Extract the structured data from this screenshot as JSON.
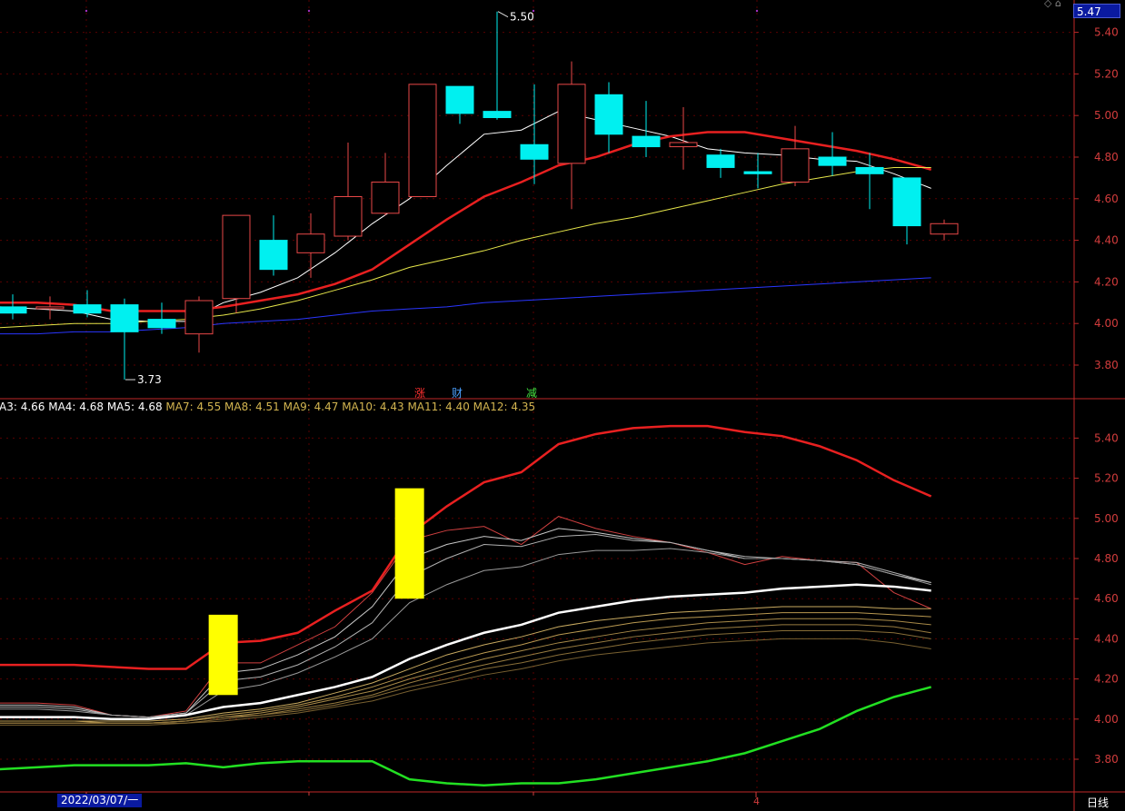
{
  "price_box": "5.47",
  "date_label": "2022/03/07/一",
  "period_label": "日线",
  "month_marker": "4",
  "corner_icons": "◇ ⌂",
  "tags": {
    "zhang": "涨",
    "cai": "财",
    "jian": "减"
  },
  "colors": {
    "up": "#e84848",
    "down": "#00f0f0",
    "axis": "#c02828",
    "grid": "#5a0000"
  },
  "ma_legend": [
    {
      "text": "A3: 4.66",
      "color": "#ffffff"
    },
    {
      "text": "MA4: 4.68",
      "color": "#ffffff"
    },
    {
      "text": "MA5: 4.68",
      "color": "#ffffff"
    },
    {
      "text": "MA7: 4.55",
      "color": "#d2b450"
    },
    {
      "text": "MA8: 4.51",
      "color": "#d2b450"
    },
    {
      "text": "MA9: 4.47",
      "color": "#d2b450"
    },
    {
      "text": "MA10: 4.43",
      "color": "#d2b450"
    },
    {
      "text": "MA11: 4.40",
      "color": "#d2b450"
    },
    {
      "text": "MA12: 4.35",
      "color": "#d2b450"
    }
  ],
  "chart_data": [
    {
      "type": "candlestick",
      "title": "",
      "ylim": [
        3.66,
        5.56
      ],
      "yticks": [
        "3.80",
        "4.00",
        "4.20",
        "4.40",
        "4.60",
        "4.80",
        "5.00",
        "5.20",
        "5.40"
      ],
      "annotations": [
        {
          "text": "5.50",
          "type": "high"
        },
        {
          "text": "3.73",
          "type": "low"
        }
      ],
      "candles": [
        {
          "o": 4.08,
          "h": 4.14,
          "l": 4.02,
          "c": 4.05
        },
        {
          "o": 4.08,
          "h": 4.13,
          "l": 4.02,
          "c": 4.08
        },
        {
          "o": 4.09,
          "h": 4.16,
          "l": 4.03,
          "c": 4.05
        },
        {
          "o": 4.09,
          "h": 4.12,
          "l": 3.73,
          "c": 3.96
        },
        {
          "o": 4.02,
          "h": 4.1,
          "l": 3.95,
          "c": 3.98
        },
        {
          "o": 3.95,
          "h": 4.13,
          "l": 3.86,
          "c": 4.11
        },
        {
          "o": 4.12,
          "h": 4.52,
          "l": 4.05,
          "c": 4.52
        },
        {
          "o": 4.4,
          "h": 4.52,
          "l": 4.23,
          "c": 4.26
        },
        {
          "o": 4.34,
          "h": 4.53,
          "l": 4.22,
          "c": 4.43
        },
        {
          "o": 4.42,
          "h": 4.87,
          "l": 4.4,
          "c": 4.61
        },
        {
          "o": 4.53,
          "h": 4.82,
          "l": 4.52,
          "c": 4.68
        },
        {
          "o": 4.61,
          "h": 5.15,
          "l": 4.61,
          "c": 5.15
        },
        {
          "o": 5.14,
          "h": 5.14,
          "l": 4.96,
          "c": 5.01
        },
        {
          "o": 5.02,
          "h": 5.5,
          "l": 4.98,
          "c": 4.99
        },
        {
          "o": 4.86,
          "h": 5.15,
          "l": 4.67,
          "c": 4.79
        },
        {
          "o": 4.77,
          "h": 5.26,
          "l": 4.55,
          "c": 5.15
        },
        {
          "o": 5.1,
          "h": 5.16,
          "l": 4.82,
          "c": 4.91
        },
        {
          "o": 4.9,
          "h": 5.07,
          "l": 4.8,
          "c": 4.85
        },
        {
          "o": 4.85,
          "h": 5.04,
          "l": 4.74,
          "c": 4.87
        },
        {
          "o": 4.81,
          "h": 4.84,
          "l": 4.7,
          "c": 4.75
        },
        {
          "o": 4.73,
          "h": 4.82,
          "l": 4.65,
          "c": 4.72
        },
        {
          "o": 4.68,
          "h": 4.95,
          "l": 4.66,
          "c": 4.84
        },
        {
          "o": 4.8,
          "h": 4.92,
          "l": 4.71,
          "c": 4.76
        },
        {
          "o": 4.75,
          "h": 4.82,
          "l": 4.55,
          "c": 4.72
        },
        {
          "o": 4.7,
          "h": 4.7,
          "l": 4.38,
          "c": 4.47
        },
        {
          "o": 4.43,
          "h": 4.5,
          "l": 4.4,
          "c": 4.48
        }
      ],
      "series": [
        {
          "color": "#ffffff",
          "values": [
            4.08,
            4.07,
            4.06,
            4.02,
            4.01,
            4.01,
            4.1,
            4.15,
            4.22,
            4.34,
            4.48,
            4.6,
            4.76,
            4.91,
            4.93,
            5.02,
            4.98,
            4.94,
            4.9,
            4.84,
            4.82,
            4.81,
            4.79,
            4.78,
            4.72,
            4.65
          ]
        },
        {
          "color": "#e82020",
          "values": [
            4.1,
            4.1,
            4.09,
            4.06,
            4.06,
            4.06,
            4.08,
            4.11,
            4.14,
            4.19,
            4.26,
            4.38,
            4.5,
            4.61,
            4.68,
            4.76,
            4.8,
            4.86,
            4.9,
            4.92,
            4.92,
            4.89,
            4.86,
            4.83,
            4.79,
            4.74
          ]
        },
        {
          "color": "#e6e64a",
          "values": [
            3.98,
            3.99,
            4.0,
            4.0,
            4.01,
            4.02,
            4.04,
            4.07,
            4.11,
            4.16,
            4.21,
            4.27,
            4.31,
            4.35,
            4.4,
            4.44,
            4.48,
            4.51,
            4.55,
            4.59,
            4.63,
            4.67,
            4.7,
            4.73,
            4.75,
            4.75
          ]
        },
        {
          "color": "#2a36ff",
          "values": [
            3.95,
            3.95,
            3.96,
            3.96,
            3.97,
            3.98,
            4.0,
            4.01,
            4.02,
            4.04,
            4.06,
            4.07,
            4.08,
            4.1,
            4.11,
            4.12,
            4.13,
            4.14,
            4.15,
            4.16,
            4.17,
            4.18,
            4.19,
            4.2,
            4.21,
            4.22
          ]
        }
      ]
    },
    {
      "type": "line",
      "title": "",
      "ylim": [
        3.69,
        5.59
      ],
      "yticks": [
        "3.80",
        "4.00",
        "4.20",
        "4.40",
        "4.60",
        "4.80",
        "5.00",
        "5.20",
        "5.40"
      ],
      "markers": [
        {
          "index": 6,
          "low": 4.12,
          "high": 4.52,
          "color": "#ffff00"
        },
        {
          "index": 11,
          "low": 4.6,
          "high": 5.15,
          "color": "#ffff00"
        }
      ],
      "series": [
        {
          "color": "#e82020",
          "width": 2.5,
          "values": [
            4.27,
            4.27,
            4.27,
            4.26,
            4.25,
            4.25,
            4.38,
            4.39,
            4.43,
            4.54,
            4.64,
            4.92,
            5.06,
            5.18,
            5.23,
            5.37,
            5.42,
            5.45,
            5.46,
            5.46,
            5.43,
            5.41,
            5.36,
            5.29,
            5.19,
            5.11
          ]
        },
        {
          "color": "#22e022",
          "width": 2.5,
          "values": [
            3.75,
            3.76,
            3.77,
            3.77,
            3.77,
            3.78,
            3.76,
            3.78,
            3.79,
            3.79,
            3.79,
            3.7,
            3.68,
            3.67,
            3.68,
            3.68,
            3.7,
            3.73,
            3.76,
            3.79,
            3.83,
            3.89,
            3.95,
            4.04,
            4.11,
            4.16
          ]
        },
        {
          "color": "#ffffff",
          "width": 2.5,
          "values": [
            4.01,
            4.01,
            4.01,
            4.0,
            4.0,
            4.02,
            4.06,
            4.08,
            4.12,
            4.16,
            4.21,
            4.3,
            4.37,
            4.43,
            4.47,
            4.53,
            4.56,
            4.59,
            4.61,
            4.62,
            4.63,
            4.65,
            4.66,
            4.67,
            4.66,
            4.64
          ]
        },
        {
          "color": "#d04040",
          "width": 1,
          "values": [
            4.08,
            4.08,
            4.07,
            4.02,
            4.01,
            4.04,
            4.28,
            4.28,
            4.37,
            4.46,
            4.63,
            4.89,
            4.94,
            4.96,
            4.87,
            5.01,
            4.95,
            4.91,
            4.88,
            4.83,
            4.77,
            4.81,
            4.79,
            4.78,
            4.63,
            4.55
          ]
        },
        {
          "color": "#c8c8c8",
          "width": 1,
          "values": [
            4.07,
            4.07,
            4.06,
            4.02,
            4.01,
            4.03,
            4.23,
            4.25,
            4.32,
            4.41,
            4.56,
            4.8,
            4.87,
            4.91,
            4.89,
            4.95,
            4.93,
            4.9,
            4.88,
            4.84,
            4.8,
            4.8,
            4.79,
            4.77,
            4.72,
            4.68
          ]
        },
        {
          "color": "#b0b0b0",
          "width": 1,
          "values": [
            4.06,
            4.06,
            4.05,
            4.02,
            4.01,
            4.03,
            4.19,
            4.21,
            4.27,
            4.36,
            4.48,
            4.71,
            4.8,
            4.87,
            4.86,
            4.91,
            4.92,
            4.89,
            4.88,
            4.84,
            4.81,
            4.8,
            4.79,
            4.78,
            4.73,
            4.68
          ]
        },
        {
          "color": "#9a9a9a",
          "width": 1,
          "values": [
            4.05,
            4.05,
            4.04,
            4.02,
            4.01,
            4.02,
            4.14,
            4.17,
            4.23,
            4.31,
            4.4,
            4.58,
            4.67,
            4.74,
            4.76,
            4.82,
            4.84,
            4.84,
            4.85,
            4.83,
            4.8,
            4.8,
            4.79,
            4.77,
            4.72,
            4.67
          ]
        },
        {
          "color": "#c8aa60",
          "width": 1,
          "values": [
            3.99,
            3.99,
            3.99,
            3.99,
            3.99,
            4.0,
            4.03,
            4.05,
            4.08,
            4.13,
            4.18,
            4.25,
            4.32,
            4.37,
            4.41,
            4.46,
            4.49,
            4.51,
            4.53,
            4.54,
            4.55,
            4.56,
            4.56,
            4.56,
            4.55,
            4.55
          ]
        },
        {
          "color": "#b89850",
          "width": 1,
          "values": [
            3.99,
            3.99,
            3.99,
            3.98,
            3.98,
            3.99,
            4.02,
            4.04,
            4.07,
            4.11,
            4.16,
            4.22,
            4.28,
            4.33,
            4.37,
            4.42,
            4.45,
            4.48,
            4.5,
            4.51,
            4.52,
            4.53,
            4.53,
            4.53,
            4.52,
            4.51
          ]
        },
        {
          "color": "#a88a48",
          "width": 1,
          "values": [
            3.98,
            3.98,
            3.98,
            3.98,
            3.98,
            3.99,
            4.01,
            4.03,
            4.06,
            4.1,
            4.14,
            4.2,
            4.25,
            4.3,
            4.34,
            4.38,
            4.41,
            4.44,
            4.46,
            4.48,
            4.49,
            4.5,
            4.5,
            4.5,
            4.49,
            4.47
          ]
        },
        {
          "color": "#987c40",
          "width": 1,
          "values": [
            3.98,
            3.98,
            3.98,
            3.98,
            3.98,
            3.99,
            4.01,
            4.02,
            4.05,
            4.08,
            4.12,
            4.18,
            4.23,
            4.27,
            4.31,
            4.35,
            4.38,
            4.41,
            4.43,
            4.45,
            4.46,
            4.47,
            4.47,
            4.47,
            4.46,
            4.43
          ]
        },
        {
          "color": "#886e38",
          "width": 1,
          "values": [
            3.98,
            3.98,
            3.98,
            3.98,
            3.98,
            3.98,
            4.0,
            4.02,
            4.04,
            4.07,
            4.11,
            4.16,
            4.2,
            4.25,
            4.28,
            4.32,
            4.35,
            4.38,
            4.4,
            4.42,
            4.43,
            4.44,
            4.44,
            4.44,
            4.43,
            4.4
          ]
        },
        {
          "color": "#786030",
          "width": 1,
          "values": [
            3.97,
            3.97,
            3.97,
            3.97,
            3.97,
            3.98,
            3.99,
            4.01,
            4.03,
            4.06,
            4.09,
            4.14,
            4.18,
            4.22,
            4.25,
            4.29,
            4.32,
            4.34,
            4.36,
            4.38,
            4.39,
            4.4,
            4.4,
            4.4,
            4.38,
            4.35
          ]
        }
      ]
    }
  ]
}
